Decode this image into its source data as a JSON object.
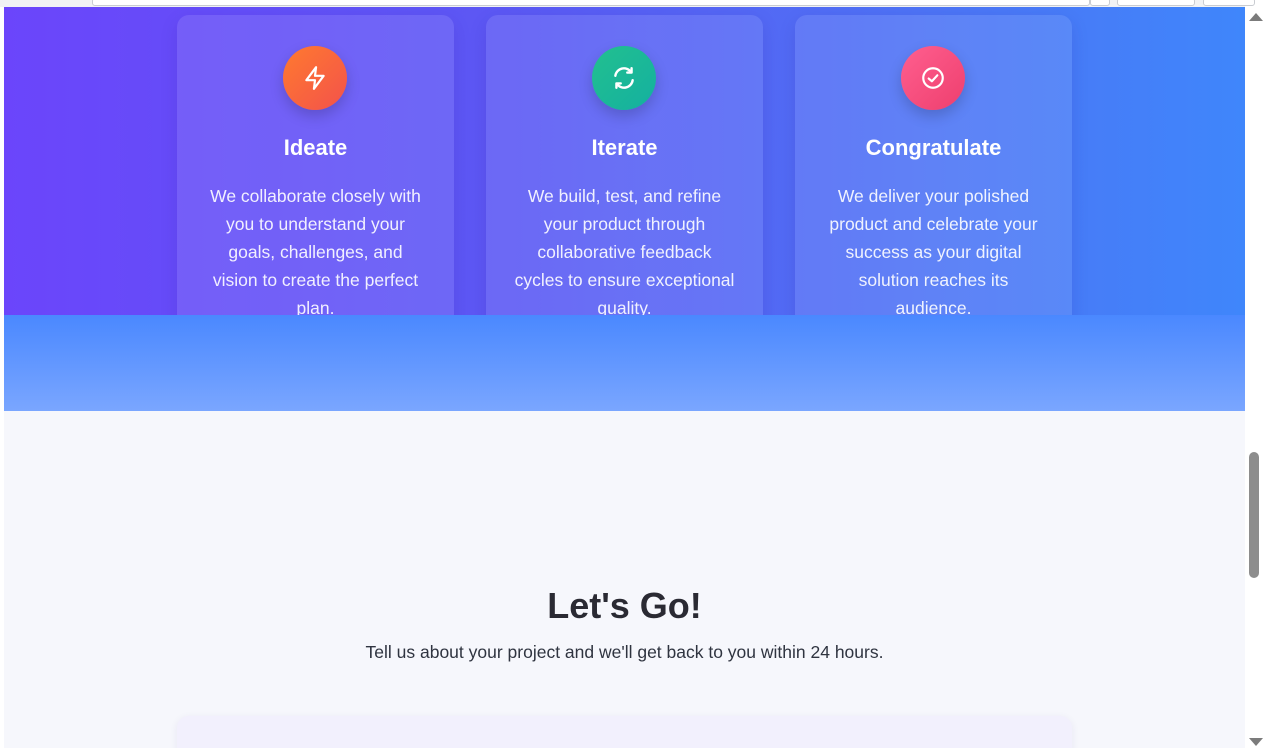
{
  "process": {
    "cards": [
      {
        "title": "Ideate",
        "description": "We collaborate closely with you to understand your goals, challenges, and vision to create the perfect plan.",
        "icon": "lightning-icon",
        "gradient": [
          "#ff7a2f",
          "#f3524b"
        ]
      },
      {
        "title": "Iterate",
        "description": "We build, test, and refine your product through collaborative feedback cycles to ensure exceptional quality.",
        "icon": "refresh-icon",
        "gradient": [
          "#22c08f",
          "#14b0a0"
        ]
      },
      {
        "title": "Congratulate",
        "description": "We deliver your polished product and celebrate your success as your digital solution reaches its audience.",
        "icon": "check-circle-icon",
        "gradient": [
          "#ff5f8f",
          "#ee3f6e"
        ]
      }
    ]
  },
  "contact": {
    "title": "Let's Go!",
    "subtitle": "Tell us about your project and we'll get back to you within 24 hours."
  },
  "colors": {
    "hero_start": "#6b45fb",
    "hero_end": "#3f86fb",
    "section_bg": "#f6f7fc",
    "heading_text": "#2a2a33"
  }
}
